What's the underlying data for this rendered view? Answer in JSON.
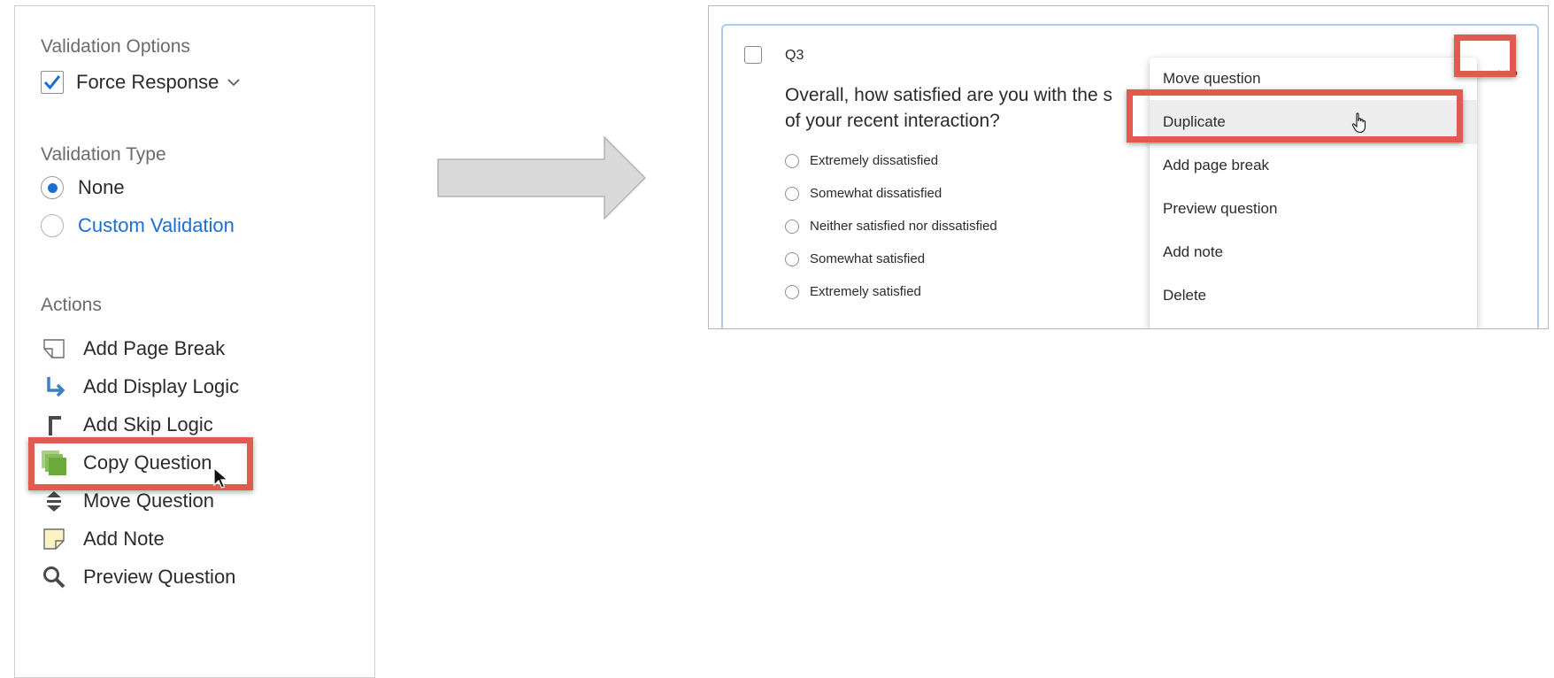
{
  "left_panel": {
    "validation_options": {
      "title": "Validation Options",
      "force_response_label": "Force Response",
      "force_response_checked": true
    },
    "validation_type": {
      "title": "Validation Type",
      "options": [
        {
          "label": "None",
          "selected": true
        },
        {
          "label": "Custom Validation",
          "selected": false
        }
      ]
    },
    "actions": {
      "title": "Actions",
      "items": [
        {
          "label": "Add Page Break",
          "icon": "page-break-icon"
        },
        {
          "label": "Add Display Logic",
          "icon": "display-logic-icon"
        },
        {
          "label": "Add Skip Logic",
          "icon": "skip-logic-icon"
        },
        {
          "label": "Copy Question",
          "icon": "copy-icon",
          "highlighted": true
        },
        {
          "label": "Move Question",
          "icon": "move-icon"
        },
        {
          "label": "Add Note",
          "icon": "note-icon"
        },
        {
          "label": "Preview Question",
          "icon": "magnifier-icon"
        }
      ]
    }
  },
  "question": {
    "id": "Q3",
    "text": "Overall, how satisfied are you with the s",
    "text_line2": "of your recent interaction?",
    "choices": [
      "Extremely dissatisfied",
      "Somewhat dissatisfied",
      "Neither satisfied nor dissatisfied",
      "Somewhat satisfied",
      "Extremely satisfied"
    ]
  },
  "menu": {
    "more_button": "•••",
    "items": [
      {
        "label": "Move question"
      },
      {
        "label": "Duplicate",
        "hover": true,
        "highlighted": true
      },
      {
        "label": "Add page break"
      },
      {
        "label": "Preview question"
      },
      {
        "label": "Add note"
      },
      {
        "label": "Delete"
      }
    ]
  },
  "colors": {
    "highlight": "#e05a4f",
    "link_blue": "#1a6fd1",
    "card_border": "#a9ccef",
    "copy_icon_green": "#6aaa3c"
  }
}
